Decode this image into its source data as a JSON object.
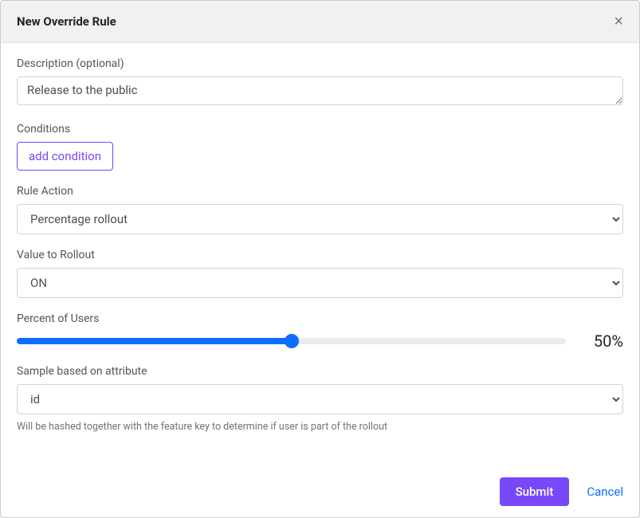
{
  "modal": {
    "title": "New Override Rule"
  },
  "form": {
    "description_label": "Description (optional)",
    "description_value": "Release to the public",
    "conditions_label": "Conditions",
    "add_condition_label": "add condition",
    "rule_action_label": "Rule Action",
    "rule_action_value": "Percentage rollout",
    "value_to_rollout_label": "Value to Rollout",
    "value_to_rollout_value": "ON",
    "percent_users_label": "Percent of Users",
    "percent_value": "50%",
    "percent_numeric": 50,
    "sample_attribute_label": "Sample based on attribute",
    "sample_attribute_value": "id",
    "sample_help_text": "Will be hashed together with the feature key to determine if user is part of the rollout"
  },
  "footer": {
    "submit_label": "Submit",
    "cancel_label": "Cancel"
  }
}
